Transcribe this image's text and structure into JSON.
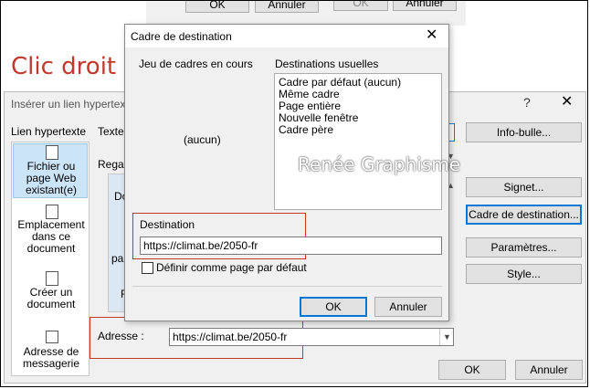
{
  "background": {
    "top_buttons": [
      "OK",
      "Annuler"
    ],
    "top_right_buttons": [
      "OK",
      "Annuler"
    ],
    "heading": "Clic droit"
  },
  "insert_dialog": {
    "title": "Insérer un lien hypertexte",
    "help": "?",
    "lien_label": "Lien hypertexte",
    "texte_label": "Texte",
    "regarder_label": "Regar",
    "side_text_1": "Do",
    "side_text_2": "pa",
    "side_text_3": "F",
    "nav_items": [
      {
        "label": "Fichier ou page Web existant(e)"
      },
      {
        "label": "Emplacement dans ce document"
      },
      {
        "label": "Créer un document"
      },
      {
        "label": "Adresse de messagerie"
      }
    ],
    "right_buttons": [
      "Info-bulle...",
      "Signet...",
      "Cadre de destination...",
      "Paramètres...",
      "Style..."
    ],
    "address_label": "Adresse :",
    "address_value": "https://climat.be/2050-fr",
    "ok": "OK",
    "cancel": "Annuler"
  },
  "frame_dialog": {
    "title": "Cadre de destination",
    "current_label": "Jeu de cadres en cours",
    "current_value": "(aucun)",
    "usual_label": "Destinations usuelles",
    "usual_list": [
      "Cadre par défaut (aucun)",
      "Même cadre",
      "Page entière",
      "Nouvelle fenêtre",
      "Cadre père"
    ],
    "destination_label": "Destination",
    "destination_value": "https://climat.be/2050-fr",
    "default_checkbox_label": "Définir comme page par défaut",
    "ok": "OK",
    "cancel": "Annuler"
  },
  "watermark": "Renée Graphisme",
  "colors": {
    "highlight_red": "#c0392b",
    "accent_blue": "#0078d7",
    "heading_red": "#c0392b"
  }
}
